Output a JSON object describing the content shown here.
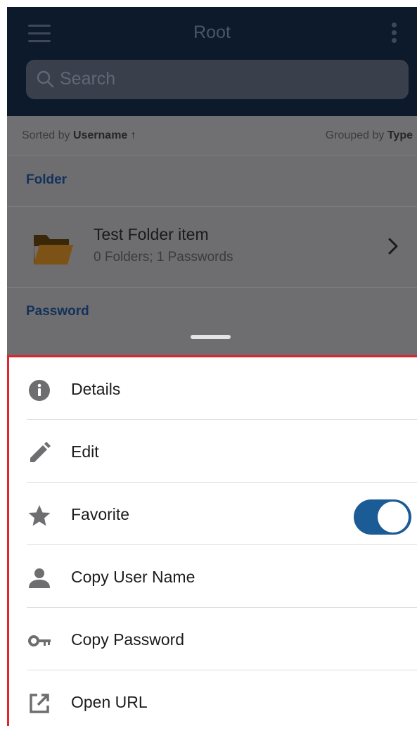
{
  "nav": {
    "title": "Root"
  },
  "search": {
    "placeholder": "Search"
  },
  "sort": {
    "prefix": "Sorted by ",
    "field": "Username ↑",
    "group_prefix": "Grouped by ",
    "group_field": "Type"
  },
  "sections": {
    "folder": "Folder",
    "password": "Password"
  },
  "folder_item": {
    "title": "Test Folder item",
    "subtitle": "0 Folders; 1 Passwords"
  },
  "actions": [
    {
      "label": "Details",
      "icon": "info-icon"
    },
    {
      "label": "Edit",
      "icon": "pencil-icon"
    },
    {
      "label": "Favorite",
      "icon": "star-icon",
      "toggle_on": true
    },
    {
      "label": "Copy User Name",
      "icon": "person-icon"
    },
    {
      "label": "Copy Password",
      "icon": "key-icon"
    },
    {
      "label": "Open URL",
      "icon": "external-link-icon"
    }
  ],
  "colors": {
    "navbar": "#0c1a2b",
    "accent": "#1b5b96",
    "highlight_border": "#e3232b",
    "section_label": "#13315a"
  }
}
